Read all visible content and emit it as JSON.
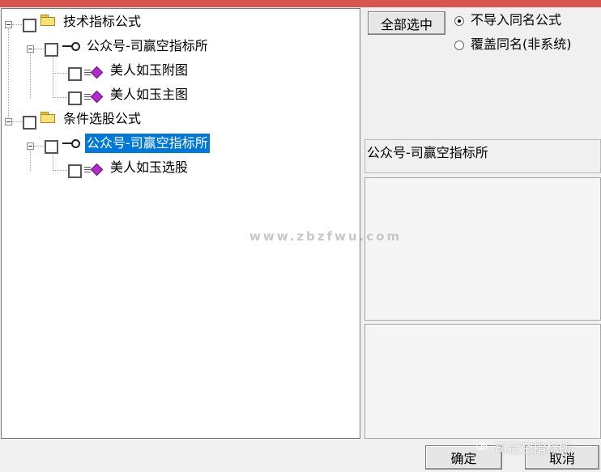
{
  "window": {
    "title_bar_color": "#d9534f"
  },
  "tree": {
    "nodes": [
      {
        "id": "tech-formula",
        "label": "技术指标公式",
        "icon": "folder-icon",
        "level": 0
      },
      {
        "id": "tech-group",
        "label": "公众号-司赢空指标所",
        "icon": "key-icon",
        "level": 1
      },
      {
        "id": "tech-item-1",
        "label": "美人如玉附图",
        "icon": "gem-icon",
        "level": 2
      },
      {
        "id": "tech-item-2",
        "label": "美人如玉主图",
        "icon": "gem-icon",
        "level": 2
      },
      {
        "id": "cond-formula",
        "label": "条件选股公式",
        "icon": "folder-icon",
        "level": 0
      },
      {
        "id": "cond-group",
        "label": "公众号-司赢空指标所",
        "icon": "key-icon",
        "level": 1,
        "selected": true
      },
      {
        "id": "cond-item-1",
        "label": "美人如玉选股",
        "icon": "gem-icon",
        "level": 2
      }
    ],
    "selection_color": "#0078d7"
  },
  "options": {
    "select_all_label": "全部选中",
    "radios": [
      {
        "label": "不导入同名公式",
        "checked": true
      },
      {
        "label": "覆盖同名(非系统)",
        "checked": false
      }
    ]
  },
  "info": {
    "name": "公众号-司赢空指标所",
    "description": "",
    "details": ""
  },
  "footer": {
    "ok_label": "确定",
    "cancel_label": "取消"
  },
  "watermark": {
    "text": "www.zbzfwu.com",
    "brand": "司赢空指标所"
  }
}
